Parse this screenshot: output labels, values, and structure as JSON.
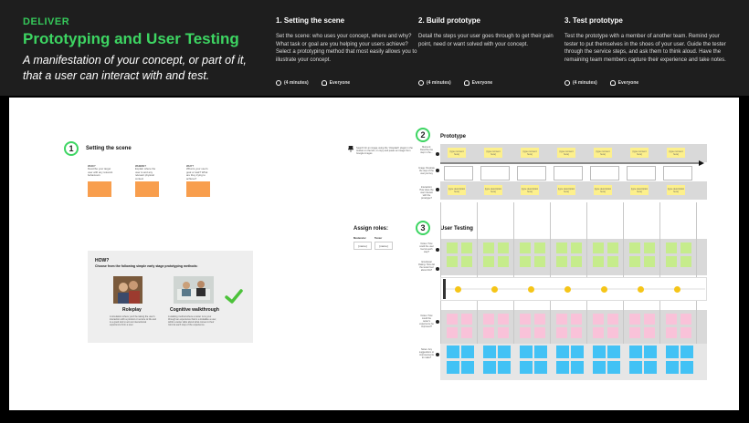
{
  "header": {
    "kicker": "DELIVER",
    "title": "Prototyping and User Testing",
    "subtitle": "A manifestation of your concept, or part of it, that a user can interact with and test.",
    "steps": [
      {
        "title": "1. Setting the scene",
        "description": "Set the scene: who uses your concept, where and why? What task or goal are you helping your users achieve? Select a prototyping method that most easily allows you to illustrate your concept.",
        "time": "(4 minutes)",
        "who": "Everyone"
      },
      {
        "title": "2. Build prototype",
        "description": "Detail the steps your user goes through to get their pain point, need or want solved with your concept.",
        "time": "(4 minutes)",
        "who": "Everyone"
      },
      {
        "title": "3. Test prototype",
        "description": "Test the prototype with a member of another team. Remind your tester to put themselves in the shoes of your user. Guide the tester through the service steps, and ask them to think aloud. Have the remaining team members capture their experience and take notes.",
        "time": "(4 minutes)",
        "who": "Everyone"
      }
    ]
  },
  "board": {
    "section1": {
      "number": "1",
      "title": "Setting the scene",
      "cols": [
        {
          "label": "WHO?",
          "text": "Describe your target user with any relevant behaviours"
        },
        {
          "label": "WHERE?",
          "text": "Explain where the user is and any relevant physical context"
        },
        {
          "label": "WHY?",
          "text": "What is your user's goal or task? What are they trying to achieve?"
        }
      ]
    },
    "how": {
      "title": "HOW?",
      "subtitle": "Choose from the following simple early stage prototyping methods:",
      "methods": [
        {
          "name": "Roleplay",
          "text": "A simulation where you'll be taking the user's interaction with a product or service to life and is a good tool to act out interactional experience from a user."
        },
        {
          "name": "Cognitive walkthrough",
          "text": "A walking method where a tester runs your through an experience that is a lookalike a user, whilst a tester talks about what comes in their mind at each step of the experience."
        }
      ]
    },
    "section2": {
      "number": "2",
      "title": "Prototype",
      "search_hint": "Search for an image using the 'Unsplash' plugin in the toolbar on the left, or copy and paste an image from Google images",
      "row_labels": [
        "Moment: Describe the step in the...",
        "Image: Illustrate the step of the user journey",
        "Interaction: How does the user interact with the prototype?"
      ],
      "sticky_top": "(type moment here)",
      "sticky_bottom": "(type description here)"
    },
    "roles": {
      "title": "Assign roles:",
      "labels": [
        "Moderator",
        "Tester"
      ],
      "placeholder": "[name]"
    },
    "section3": {
      "number": "3",
      "title": "User Testing",
      "row_labels": [
        "Notes: How could the user feel at each step?",
        "Emotional Rating: How did the tester feel about this?",
        "Notes: How could the tester's experience be improved?",
        "Notes: Any suggestions or improvements to make?"
      ]
    }
  },
  "colors": {
    "accent": "#3dd562",
    "orange": "#f89e4d",
    "yellow": "#fdf08c",
    "green_note": "#c6ec8c",
    "pink_note": "#f9c2d9",
    "blue_note": "#42c2f5",
    "emotion_dot": "#f5c518"
  },
  "icons": [
    "timer-icon",
    "user-icon",
    "pin-icon",
    "checkmark-icon"
  ]
}
